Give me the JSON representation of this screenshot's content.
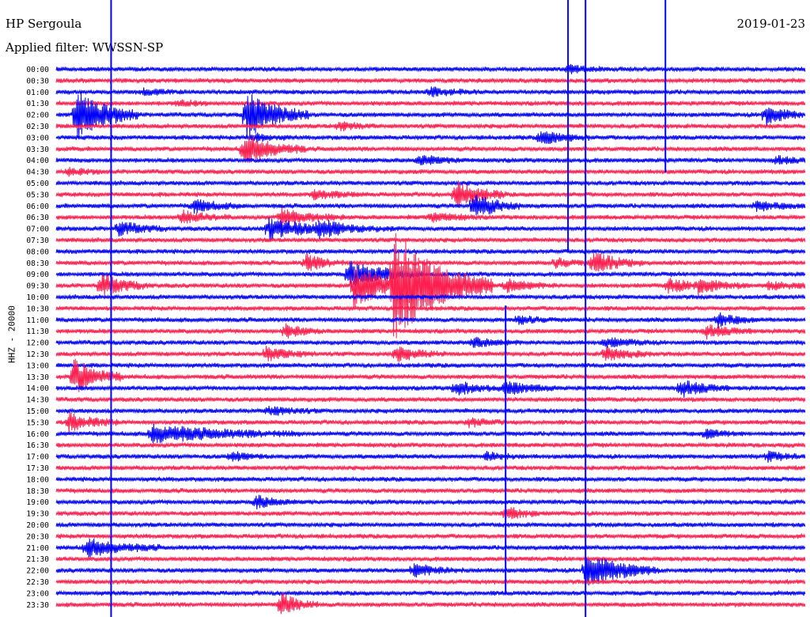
{
  "header": {
    "station": "HP Sergoula",
    "date": "2019-01-23",
    "filter": "Applied filter: WWSSN-SP"
  },
  "chart_data": {
    "type": "line",
    "title": "HP Sergoula",
    "subtitle": "Applied filter: WWSSN-SP",
    "ylabel": "HHZ - 20000",
    "xlabel": "",
    "date": "2019-01-23",
    "row_minutes": 30,
    "row_colors": [
      "#0000ff",
      "#ff1f4f"
    ],
    "grid": false,
    "rows": [
      "00:00",
      "00:30",
      "01:00",
      "01:30",
      "02:00",
      "02:30",
      "03:00",
      "03:30",
      "04:00",
      "04:30",
      "05:00",
      "05:30",
      "06:00",
      "06:30",
      "07:00",
      "07:30",
      "08:00",
      "08:30",
      "09:00",
      "09:30",
      "10:00",
      "10:30",
      "11:00",
      "11:30",
      "12:00",
      "12:30",
      "13:00",
      "13:30",
      "14:00",
      "14:30",
      "15:00",
      "15:30",
      "16:00",
      "16:30",
      "17:00",
      "17:30",
      "18:00",
      "18:30",
      "19:00",
      "19:30",
      "20:00",
      "20:30",
      "21:00",
      "21:30",
      "22:00",
      "22:30",
      "23:00",
      "23:30"
    ],
    "events": [
      {
        "row": 0,
        "minute": 20.5,
        "amplitude": 0.8,
        "duration": 2.0
      },
      {
        "row": 2,
        "minute": 3.5,
        "amplitude": 0.7,
        "duration": 1.5
      },
      {
        "row": 2,
        "minute": 15.0,
        "amplitude": 0.9,
        "duration": 2.0
      },
      {
        "row": 3,
        "minute": 4.8,
        "amplitude": 0.7,
        "duration": 1.5
      },
      {
        "row": 4,
        "minute": 0.8,
        "amplitude": 6.0,
        "duration": 2.5
      },
      {
        "row": 4,
        "minute": 7.6,
        "amplitude": 5.5,
        "duration": 2.5
      },
      {
        "row": 4,
        "minute": 28.4,
        "amplitude": 2.5,
        "duration": 1.5
      },
      {
        "row": 5,
        "minute": 11.3,
        "amplitude": 1.0,
        "duration": 1.5
      },
      {
        "row": 6,
        "minute": 7.9,
        "amplitude": 0.9,
        "duration": 1.5
      },
      {
        "row": 6,
        "minute": 19.4,
        "amplitude": 1.5,
        "duration": 2.0
      },
      {
        "row": 7,
        "minute": 7.5,
        "amplitude": 3.5,
        "duration": 2.5
      },
      {
        "row": 8,
        "minute": 14.5,
        "amplitude": 1.0,
        "duration": 2.0
      },
      {
        "row": 8,
        "minute": 28.8,
        "amplitude": 1.0,
        "duration": 1.5
      },
      {
        "row": 9,
        "minute": 0.5,
        "amplitude": 0.8,
        "duration": 1.5
      },
      {
        "row": 11,
        "minute": 10.3,
        "amplitude": 1.0,
        "duration": 2.0
      },
      {
        "row": 11,
        "minute": 16.0,
        "amplitude": 3.0,
        "duration": 2.0
      },
      {
        "row": 12,
        "minute": 5.5,
        "amplitude": 1.5,
        "duration": 2.0
      },
      {
        "row": 12,
        "minute": 16.7,
        "amplitude": 3.0,
        "duration": 2.0
      },
      {
        "row": 12,
        "minute": 28.0,
        "amplitude": 1.0,
        "duration": 2.0
      },
      {
        "row": 13,
        "minute": 5.0,
        "amplitude": 1.5,
        "duration": 2.0
      },
      {
        "row": 13,
        "minute": 9.0,
        "amplitude": 2.0,
        "duration": 2.5
      },
      {
        "row": 13,
        "minute": 15.0,
        "amplitude": 1.0,
        "duration": 2.0
      },
      {
        "row": 14,
        "minute": 2.5,
        "amplitude": 1.5,
        "duration": 2.0
      },
      {
        "row": 14,
        "minute": 8.5,
        "amplitude": 2.5,
        "duration": 3.0
      },
      {
        "row": 14,
        "minute": 10.5,
        "amplitude": 1.5,
        "duration": 3.0
      },
      {
        "row": 17,
        "minute": 10.0,
        "amplitude": 2.0,
        "duration": 1.5
      },
      {
        "row": 17,
        "minute": 20.0,
        "amplitude": 1.0,
        "duration": 1.5
      },
      {
        "row": 17,
        "minute": 21.5,
        "amplitude": 2.5,
        "duration": 2.0
      },
      {
        "row": 18,
        "minute": 11.7,
        "amplitude": 3.0,
        "duration": 3.0
      },
      {
        "row": 19,
        "minute": 1.8,
        "amplitude": 2.5,
        "duration": 2.0
      },
      {
        "row": 19,
        "minute": 11.9,
        "amplitude": 5.0,
        "duration": 3.0
      },
      {
        "row": 19,
        "minute": 13.5,
        "amplitude": 12.0,
        "duration": 4.0
      },
      {
        "row": 19,
        "minute": 18.0,
        "amplitude": 1.5,
        "duration": 2.0
      },
      {
        "row": 19,
        "minute": 24.5,
        "amplitude": 1.5,
        "duration": 2.0
      },
      {
        "row": 19,
        "minute": 25.7,
        "amplitude": 1.5,
        "duration": 2.0
      },
      {
        "row": 19,
        "minute": 28.5,
        "amplitude": 1.0,
        "duration": 2.0
      },
      {
        "row": 22,
        "minute": 18.5,
        "amplitude": 1.0,
        "duration": 1.5
      },
      {
        "row": 22,
        "minute": 26.5,
        "amplitude": 1.5,
        "duration": 1.5
      },
      {
        "row": 23,
        "minute": 9.2,
        "amplitude": 1.5,
        "duration": 1.5
      },
      {
        "row": 23,
        "minute": 26.0,
        "amplitude": 1.5,
        "duration": 2.0
      },
      {
        "row": 24,
        "minute": 16.7,
        "amplitude": 1.0,
        "duration": 2.0
      },
      {
        "row": 24,
        "minute": 22.0,
        "amplitude": 1.0,
        "duration": 2.0
      },
      {
        "row": 25,
        "minute": 8.4,
        "amplitude": 1.5,
        "duration": 2.0
      },
      {
        "row": 25,
        "minute": 13.6,
        "amplitude": 1.5,
        "duration": 2.0
      },
      {
        "row": 25,
        "minute": 22.0,
        "amplitude": 1.5,
        "duration": 2.0
      },
      {
        "row": 27,
        "minute": 0.7,
        "amplitude": 4.0,
        "duration": 2.0
      },
      {
        "row": 28,
        "minute": 25.0,
        "amplitude": 2.0,
        "duration": 2.0
      },
      {
        "row": 28,
        "minute": 18.0,
        "amplitude": 1.5,
        "duration": 2.0
      },
      {
        "row": 28,
        "minute": 16.0,
        "amplitude": 1.5,
        "duration": 2.0
      },
      {
        "row": 30,
        "minute": 8.5,
        "amplitude": 1.0,
        "duration": 2.0
      },
      {
        "row": 31,
        "minute": 0.5,
        "amplitude": 2.0,
        "duration": 2.0
      },
      {
        "row": 31,
        "minute": 16.5,
        "amplitude": 1.0,
        "duration": 1.5
      },
      {
        "row": 32,
        "minute": 3.8,
        "amplitude": 2.0,
        "duration": 6.0
      },
      {
        "row": 32,
        "minute": 26.0,
        "amplitude": 1.0,
        "duration": 1.5
      },
      {
        "row": 34,
        "minute": 7.0,
        "amplitude": 1.0,
        "duration": 1.5
      },
      {
        "row": 34,
        "minute": 17.2,
        "amplitude": 1.0,
        "duration": 1.5
      },
      {
        "row": 34,
        "minute": 28.5,
        "amplitude": 1.0,
        "duration": 1.5
      },
      {
        "row": 38,
        "minute": 8.0,
        "amplitude": 1.5,
        "duration": 1.5
      },
      {
        "row": 39,
        "minute": 18.0,
        "amplitude": 1.5,
        "duration": 1.5
      },
      {
        "row": 42,
        "minute": 1.2,
        "amplitude": 2.0,
        "duration": 3.0
      },
      {
        "row": 44,
        "minute": 14.3,
        "amplitude": 1.5,
        "duration": 2.0
      },
      {
        "row": 44,
        "minute": 21.2,
        "amplitude": 4.0,
        "duration": 3.0
      },
      {
        "row": 47,
        "minute": 9.0,
        "amplitude": 2.5,
        "duration": 1.5
      }
    ],
    "spikes": [
      {
        "minute": 2.2,
        "rows": [
          0,
          47
        ]
      },
      {
        "minute": 18.0,
        "rows": [
          27,
          44
        ]
      },
      {
        "minute": 20.5,
        "rows": [
          0,
          14
        ]
      },
      {
        "minute": 21.2,
        "rows": [
          0,
          47
        ]
      },
      {
        "minute": 24.4,
        "rows": [
          0,
          7
        ]
      }
    ]
  }
}
